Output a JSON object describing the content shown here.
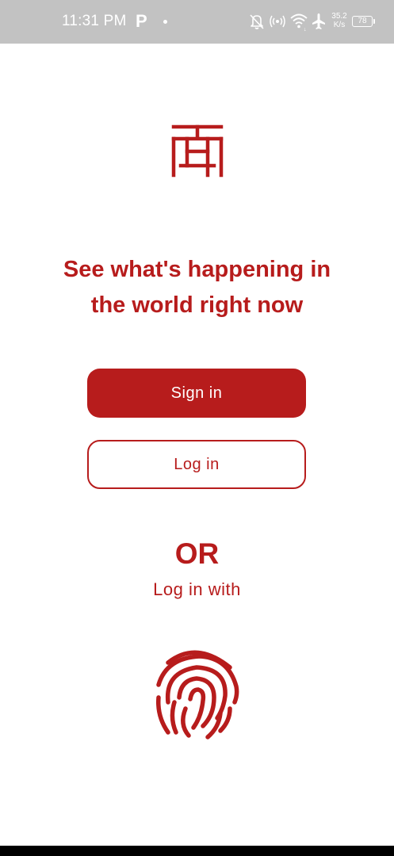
{
  "status_bar": {
    "time": "11:31 PM",
    "parking_icon": "P",
    "net_speed_value": "35.2",
    "net_speed_unit": "K/s",
    "battery_level": "78"
  },
  "logo": {
    "icon": "red-seal-logo-icon"
  },
  "headline": {
    "line1": "See what's happening in",
    "line2": "the world right now"
  },
  "buttons": {
    "sign_in": "Sign in",
    "log_in": "Log in"
  },
  "alternate": {
    "or_label": "OR",
    "login_with_label": "Log in with",
    "fingerprint_icon": "fingerprint-icon"
  },
  "colors": {
    "accent": "#b71c1c",
    "status_bar": "#c2c2c2",
    "background": "#ffffff"
  }
}
